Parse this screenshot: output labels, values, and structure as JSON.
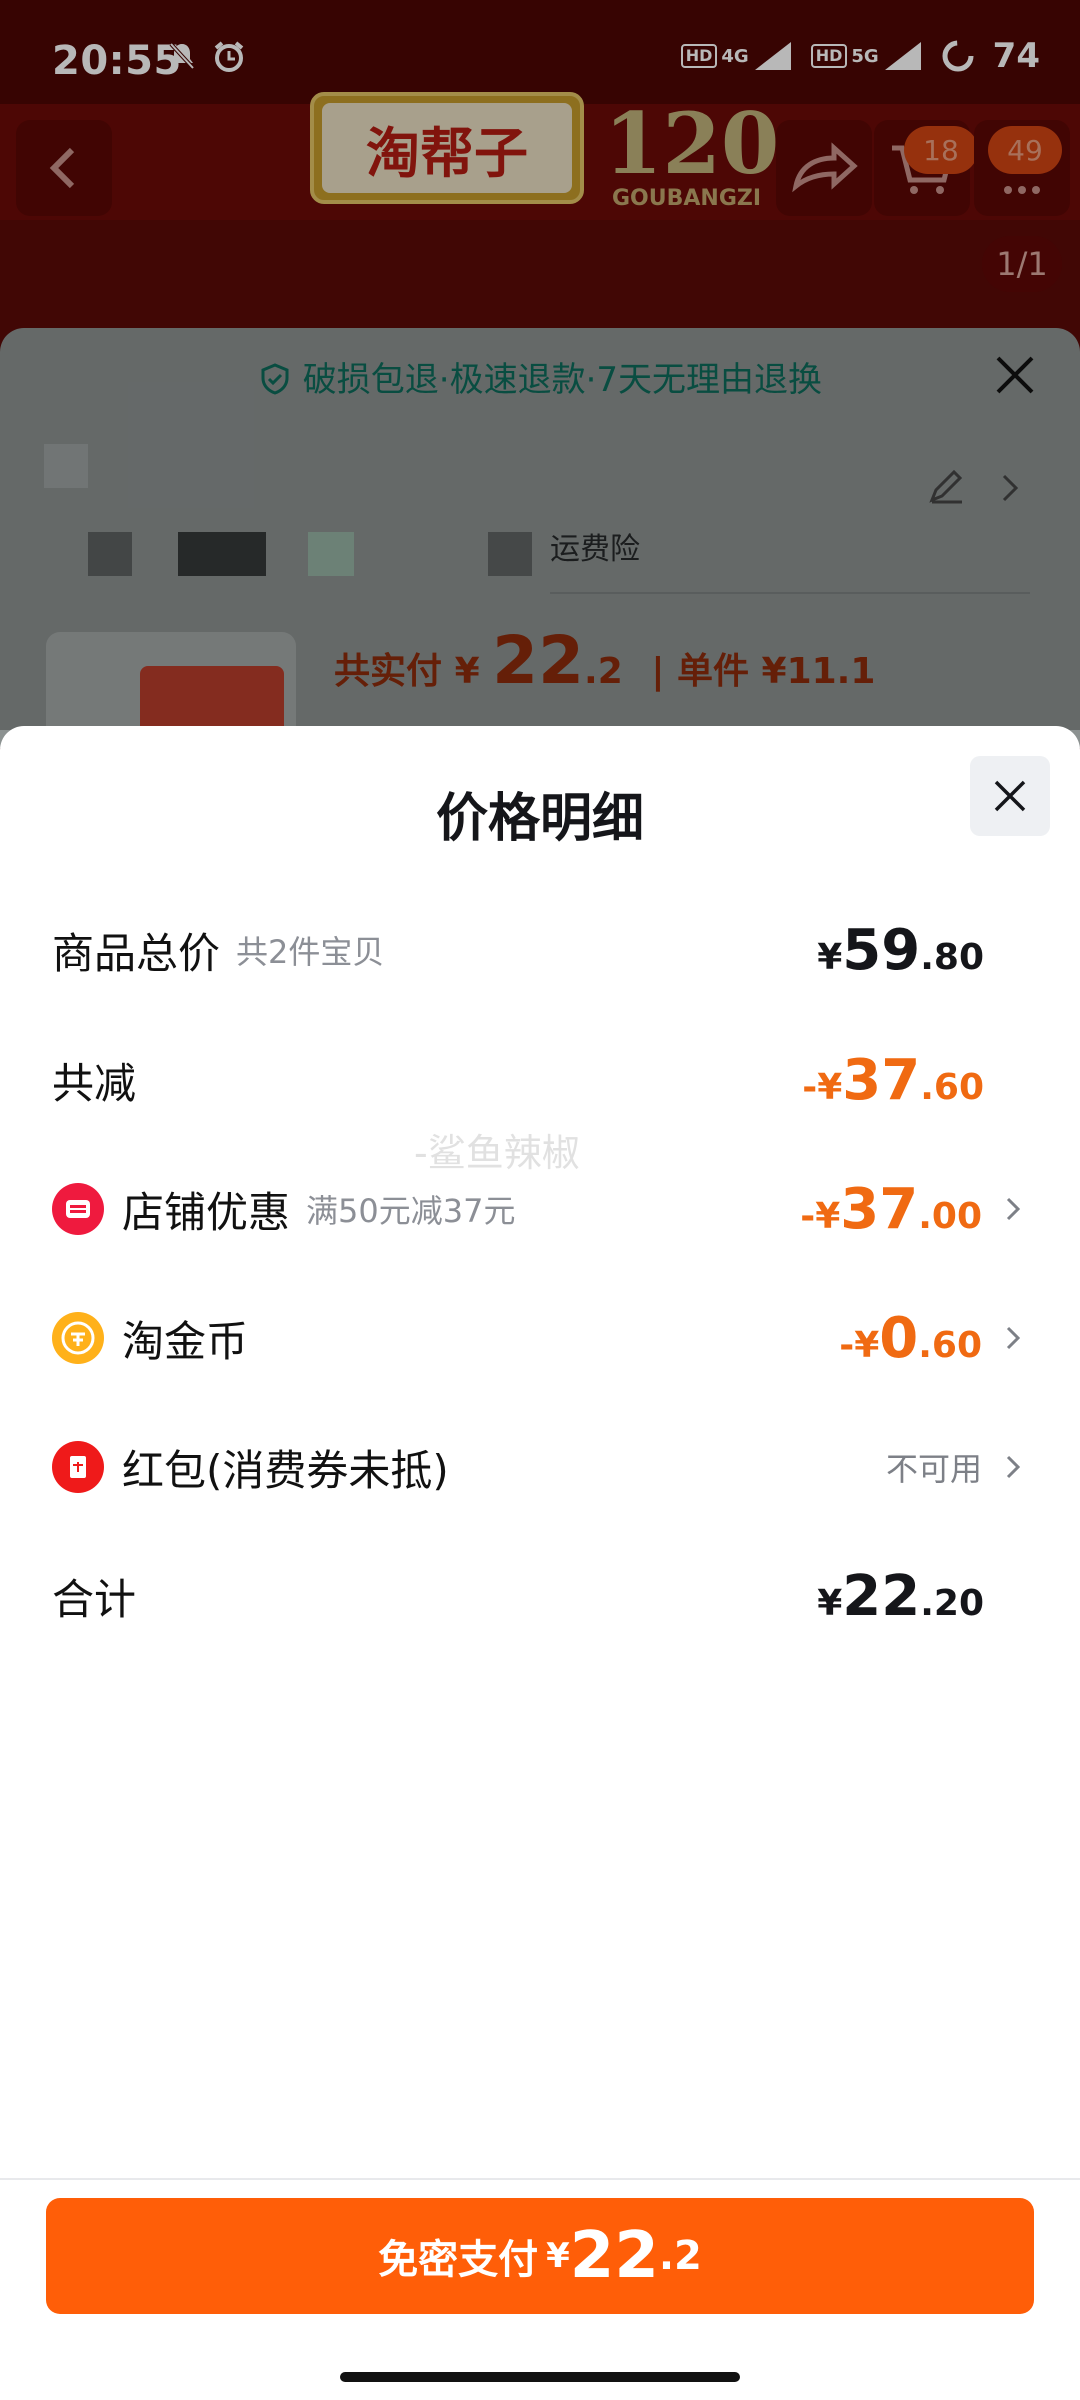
{
  "status_bar": {
    "time": "20:55",
    "network1": "4G",
    "network2": "5G",
    "battery": "74"
  },
  "header": {
    "logo_text": "淘帮子",
    "logo_sub": "GOUBANGZI",
    "cart_count": "18",
    "msg_count": "49",
    "pager": "1/1"
  },
  "background_sheet": {
    "guarantee": "破损包退·极速退款·7天无理由退换",
    "insurance_fragment": "运费险",
    "price_prefix": "共实付",
    "price_cur": "¥",
    "price_int": "22",
    "price_dec": ".2",
    "unit_label": "| 单件 ¥11.1"
  },
  "modal": {
    "title": "价格明细",
    "rows": [
      {
        "label": "商品总价",
        "sub": "共2件宝贝",
        "cur": "¥",
        "int": "59",
        "dec": ".80"
      },
      {
        "label": "共减",
        "cur": "-¥",
        "int": "37",
        "dec": ".60"
      },
      {
        "label": "店铺优惠",
        "sub": "满50元减37元",
        "cur": "-¥",
        "int": "37",
        "dec": ".00",
        "icon": "store-coupon-icon"
      },
      {
        "label": "淘金币",
        "cur": "-¥",
        "int": "0",
        "dec": ".60",
        "icon": "gold-coin-icon"
      },
      {
        "label": "红包(消费券未抵)",
        "status": "不可用",
        "icon": "red-packet-icon"
      },
      {
        "label": "合计",
        "cur": "¥",
        "int": "22",
        "dec": ".20"
      }
    ],
    "watermark": "-鲨鱼辣椒"
  },
  "pay_button": {
    "text": "免密支付",
    "cur": "¥",
    "int": "22",
    "dec": ".2"
  },
  "colors": {
    "accent": "#ff5e08",
    "discount": "#f06a12"
  }
}
